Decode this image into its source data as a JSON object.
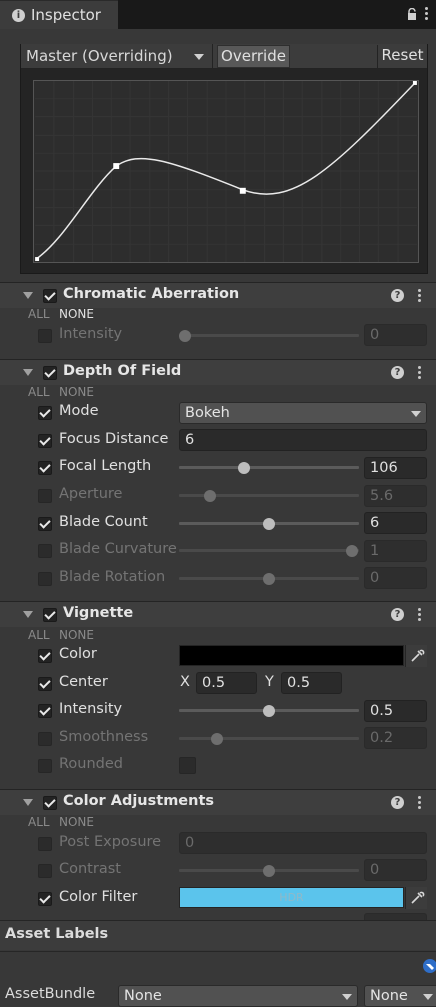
{
  "tab": {
    "title": "Inspector"
  },
  "curve": {
    "mode": "Master (Overriding)",
    "override_label": "Override",
    "reset_label": "Reset"
  },
  "sections": {
    "chromatic": {
      "title": "Chromatic Aberration",
      "all": "ALL",
      "none": "NONE",
      "intensity": {
        "label": "Intensity",
        "value": "0",
        "level": 0
      }
    },
    "dof": {
      "title": "Depth Of Field",
      "all": "ALL",
      "none": "NONE",
      "mode": {
        "label": "Mode",
        "value": "Bokeh"
      },
      "focus_distance": {
        "label": "Focus Distance",
        "value": "6"
      },
      "focal_length": {
        "label": "Focal Length",
        "value": "106",
        "level": 0.36
      },
      "aperture": {
        "label": "Aperture",
        "value": "5.6",
        "level": 0.17
      },
      "blade_count": {
        "label": "Blade Count",
        "value": "6",
        "level": 0.5
      },
      "blade_curvature": {
        "label": "Blade Curvature",
        "value": "1",
        "level": 1.0
      },
      "blade_rotation": {
        "label": "Blade Rotation",
        "value": "0",
        "level": 0.5
      }
    },
    "vignette": {
      "title": "Vignette",
      "all": "ALL",
      "none": "NONE",
      "color": {
        "label": "Color",
        "value": "#000000"
      },
      "center": {
        "label": "Center",
        "x_label": "X",
        "x": "0.5",
        "y_label": "Y",
        "y": "0.5"
      },
      "intensity": {
        "label": "Intensity",
        "value": "0.5",
        "level": 0.5
      },
      "smoothness": {
        "label": "Smoothness",
        "value": "0.2",
        "level": 0.2
      },
      "rounded": {
        "label": "Rounded"
      }
    },
    "color_adjustments": {
      "title": "Color Adjustments",
      "all": "ALL",
      "none": "NONE",
      "post_exposure": {
        "label": "Post Exposure",
        "value": "0"
      },
      "contrast": {
        "label": "Contrast",
        "value": "0",
        "level": 0.5
      },
      "color_filter": {
        "label": "Color Filter",
        "value": "#5bc4ec",
        "hdr_label": "HDR"
      }
    }
  },
  "asset_labels": {
    "title": "Asset Labels"
  },
  "asset_bundle": {
    "label": "AssetBundle",
    "name": "None",
    "variant": "None"
  },
  "icons": [
    "info-icon",
    "lock-icon",
    "menu-icon",
    "help-icon",
    "eyedropper-icon",
    "tag-icon"
  ]
}
